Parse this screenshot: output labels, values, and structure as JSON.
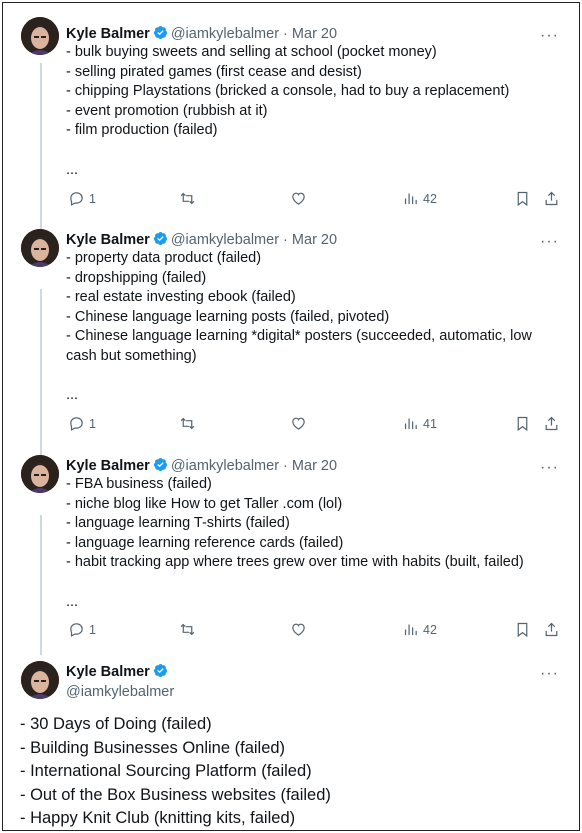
{
  "tweets": [
    {
      "name": "Kyle Balmer",
      "handle": "@iamkylebalmer",
      "date": "Mar 20",
      "lines": [
        "- bulk buying sweets and selling at school (pocket money)",
        "- selling pirated games (first cease and desist)",
        "- chipping Playstations (bricked a console, had to buy a replacement)",
        "- event promotion (rubbish at it)",
        "- film production (failed)",
        "",
        "",
        "..."
      ],
      "replies": "1",
      "views": "42"
    },
    {
      "name": "Kyle Balmer",
      "handle": "@iamkylebalmer",
      "date": "Mar 20",
      "lines": [
        "- property data product (failed)",
        "- dropshipping (failed)",
        "- real estate investing ebook (failed)",
        "- Chinese language learning posts (failed, pivoted)",
        "- Chinese language learning *digital* posters (succeeded, automatic, low cash but something)",
        "",
        "..."
      ],
      "replies": "1",
      "views": "41"
    },
    {
      "name": "Kyle Balmer",
      "handle": "@iamkylebalmer",
      "date": "Mar 20",
      "lines": [
        "- FBA business (failed)",
        "- niche blog like How to get Taller .com (lol)",
        "- language learning T-shirts (failed)",
        "- language learning reference cards (failed)",
        "- habit tracking app where trees grew over time with habits (built, failed)",
        "",
        "..."
      ],
      "replies": "1",
      "views": "42"
    }
  ],
  "main_tweet": {
    "name": "Kyle Balmer",
    "handle": "@iamkylebalmer",
    "lines": [
      "- 30 Days of Doing (failed)",
      "- Building Businesses Online (failed)",
      "- International Sourcing Platform (failed)",
      "- Out of the Box Business websites (failed)",
      "- Happy Knit Club (knitting kits, failed)"
    ]
  },
  "ui": {
    "more_glyph": "···",
    "separator": " · ",
    "verified_color": "#1d9bf0"
  }
}
